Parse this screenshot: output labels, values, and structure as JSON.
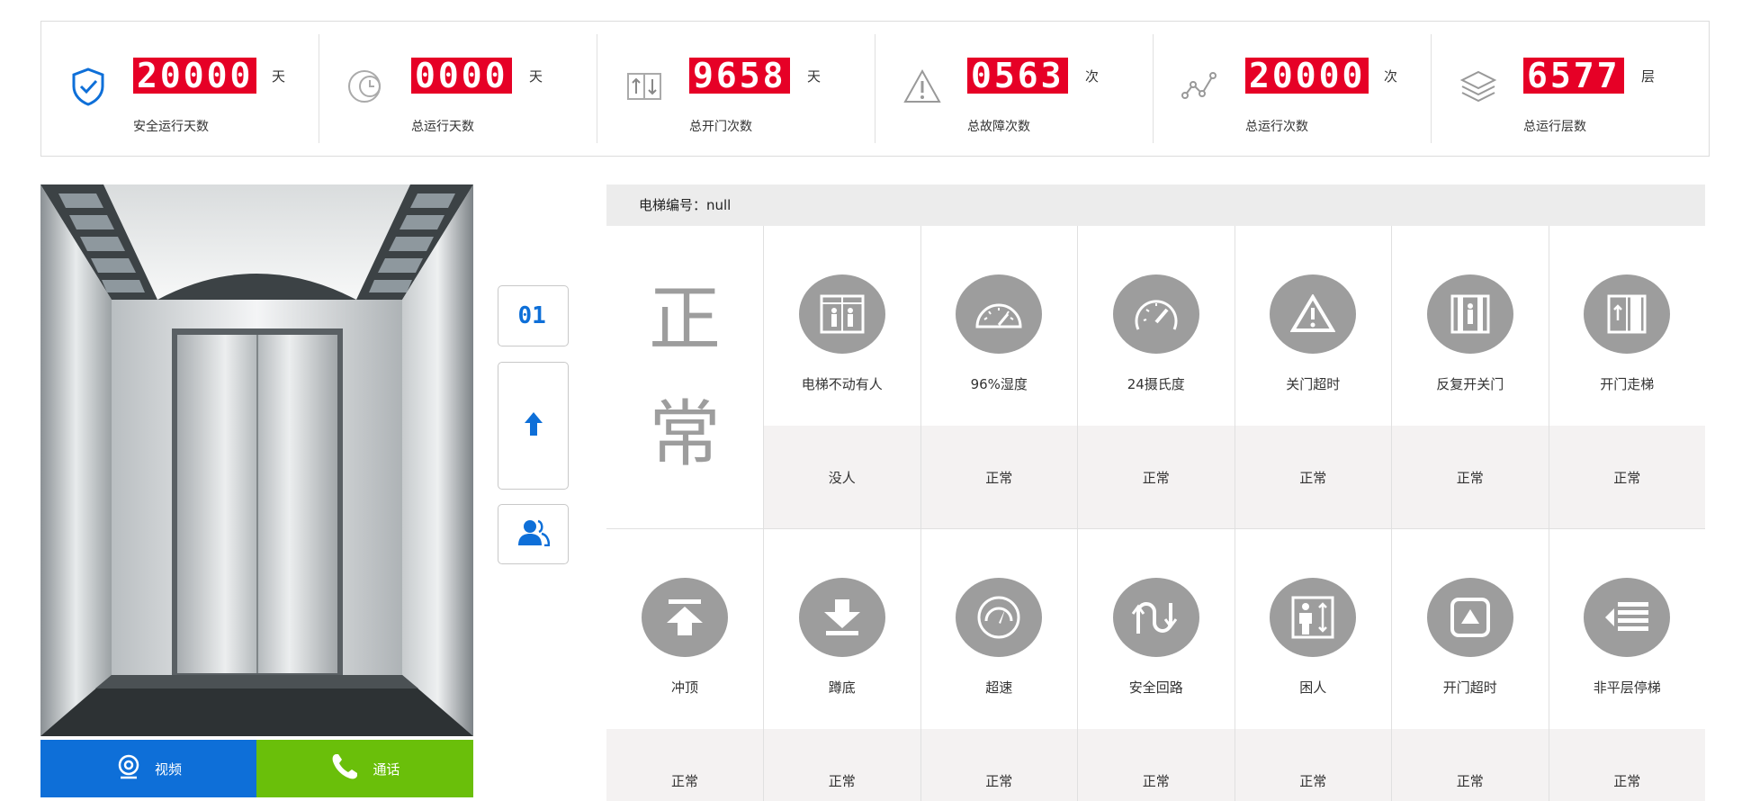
{
  "stats": [
    {
      "value": "20000",
      "unit": "天",
      "label": "安全运行天数",
      "icon": "shield-check-icon"
    },
    {
      "value": "0000",
      "unit": "天",
      "label": "总运行天数",
      "icon": "clock-icon"
    },
    {
      "value": "9658",
      "unit": "天",
      "label": "总开门次数",
      "icon": "door-arrows-icon"
    },
    {
      "value": "0563",
      "unit": "次",
      "label": "总故障次数",
      "icon": "warning-icon"
    },
    {
      "value": "20000",
      "unit": "次",
      "label": "总运行次数",
      "icon": "trend-icon"
    },
    {
      "value": "6577",
      "unit": "层",
      "label": "总运行层数",
      "icon": "layers-icon"
    }
  ],
  "floor_display": "01",
  "buttons": {
    "video": "视频",
    "call": "通话"
  },
  "grid": {
    "header": "电梯编号：null",
    "status_big_1": "正",
    "status_big_2": "常",
    "row1": [
      {
        "name": "电梯不动有人",
        "value": "没人",
        "icon": "elevator-person-icon"
      },
      {
        "name": "96%湿度",
        "value": "正常",
        "icon": "humidity-gauge-icon"
      },
      {
        "name": "24摄氏度",
        "value": "正常",
        "icon": "temperature-gauge-icon"
      },
      {
        "name": "关门超时",
        "value": "正常",
        "icon": "warning-triangle-icon"
      },
      {
        "name": "反复开关门",
        "value": "正常",
        "icon": "door-repeat-icon"
      },
      {
        "name": "开门走梯",
        "value": "正常",
        "icon": "door-open-icon"
      }
    ],
    "row2": [
      {
        "name": "冲顶",
        "value": "正常",
        "icon": "up-arrow-icon"
      },
      {
        "name": "蹲底",
        "value": "正常",
        "icon": "down-arrow-icon"
      },
      {
        "name": "超速",
        "value": "正常",
        "icon": "speedometer-icon"
      },
      {
        "name": "安全回路",
        "value": "正常",
        "icon": "loop-icon"
      },
      {
        "name": "困人",
        "value": "正常",
        "icon": "trapped-person-icon"
      },
      {
        "name": "开门超时",
        "value": "正常",
        "icon": "door-timeout-icon"
      },
      {
        "name": "非平层停梯",
        "value": "正常",
        "icon": "level-stop-icon"
      }
    ]
  },
  "colors": {
    "accent": "#0e6fd8",
    "counter_bg": "#e60026",
    "call_green": "#6abf0a",
    "icon_grey": "#9d9d9d"
  }
}
